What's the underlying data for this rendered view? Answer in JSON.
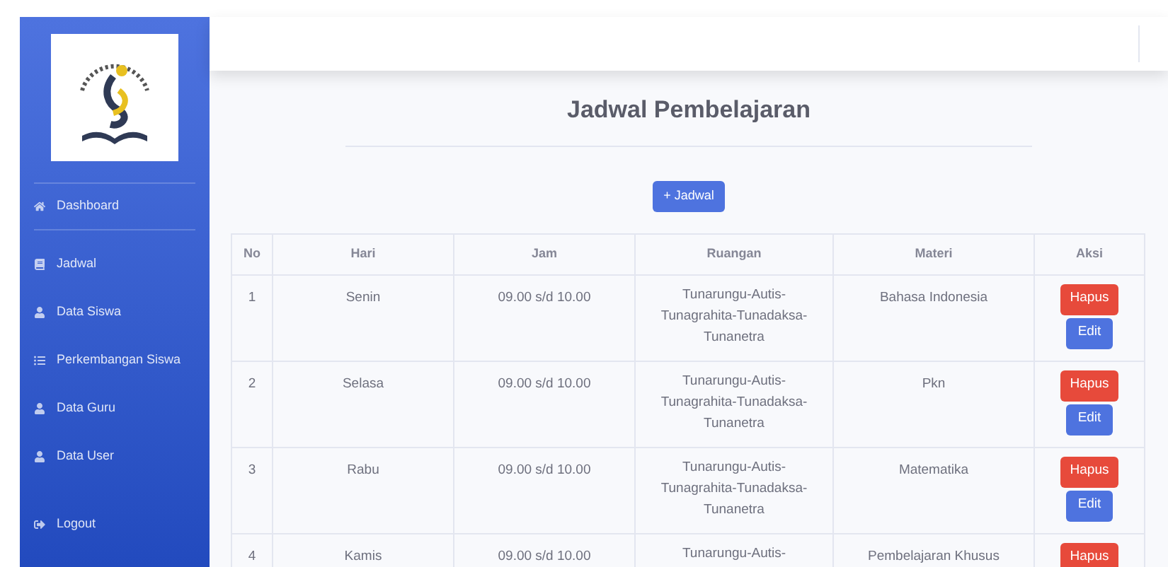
{
  "sidebar": {
    "items": [
      {
        "label": "Dashboard"
      },
      {
        "label": "Jadwal"
      },
      {
        "label": "Data Siswa"
      },
      {
        "label": "Perkembangan Siswa"
      },
      {
        "label": "Data Guru"
      },
      {
        "label": "Data User"
      },
      {
        "label": "Logout"
      }
    ]
  },
  "page_title": "Jadwal Pembelajaran",
  "add_button": "+ Jadwal",
  "table": {
    "columns": [
      "No",
      "Hari",
      "Jam",
      "Ruangan",
      "Materi",
      "Aksi"
    ],
    "rows": [
      {
        "no": "1",
        "hari": "Senin",
        "jam": "09.00 s/d 10.00",
        "ruangan": [
          "Tunarungu-Autis-",
          "Tunagrahita-Tunadaksa-",
          "Tunanetra"
        ],
        "materi": "Bahasa Indonesia",
        "actions": [
          "Hapus",
          "Edit"
        ]
      },
      {
        "no": "2",
        "hari": "Selasa",
        "jam": "09.00 s/d 10.00",
        "ruangan": [
          "Tunarungu-Autis-",
          "Tunagrahita-Tunadaksa-",
          "Tunanetra"
        ],
        "materi": "Pkn",
        "actions": [
          "Hapus",
          "Edit"
        ]
      },
      {
        "no": "3",
        "hari": "Rabu",
        "jam": "09.00 s/d 10.00",
        "ruangan": [
          "Tunarungu-Autis-",
          "Tunagrahita-Tunadaksa-",
          "Tunanetra"
        ],
        "materi": "Matematika",
        "actions": [
          "Hapus",
          "Edit"
        ]
      },
      {
        "no": "4",
        "hari": "Kamis",
        "jam": "09.00 s/d 10.00",
        "ruangan": [
          "Tunarungu-Autis-"
        ],
        "materi": "Pembelajaran Khusus",
        "actions": [
          "Hapus"
        ]
      }
    ]
  }
}
